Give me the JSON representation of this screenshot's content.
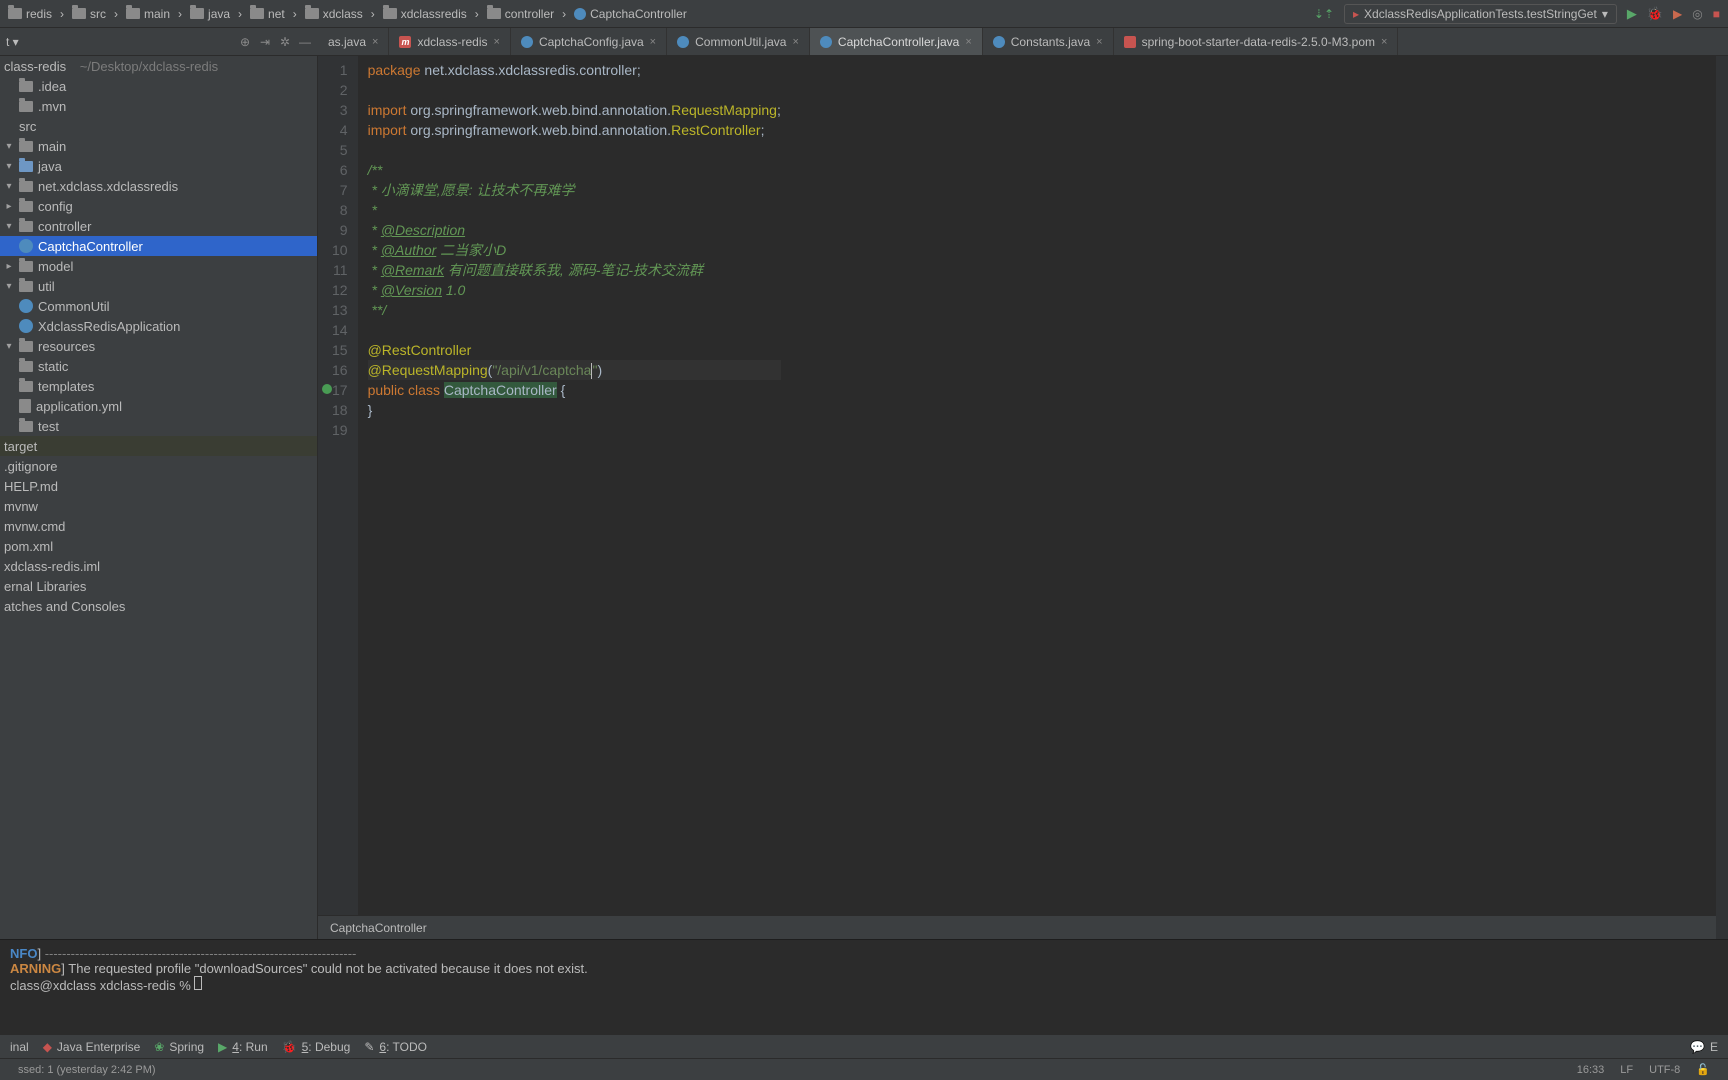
{
  "breadcrumbs": [
    "redis",
    "src",
    "main",
    "java",
    "net",
    "xdclass",
    "xdclassredis",
    "controller",
    "CaptchaController"
  ],
  "run_config": "XdclassRedisApplicationTests.testStringGet",
  "project": {
    "root_label": "class-redis",
    "root_path": "~/Desktop/xdclass-redis",
    "tool_label": "t",
    "nodes": {
      "idea": ".idea",
      "mvn": ".mvn",
      "src": "src",
      "main": "main",
      "java": "java",
      "pkg": "net.xdclass.xdclassredis",
      "config": "config",
      "controller": "controller",
      "captcha": "CaptchaController",
      "model": "model",
      "util": "util",
      "commonutil": "CommonUtil",
      "app": "XdclassRedisApplication",
      "resources": "resources",
      "static": "static",
      "templates": "templates",
      "appyml": "application.yml",
      "test": "test",
      "target": "target",
      "gitignore": ".gitignore",
      "help": "HELP.md",
      "mvnw": "mvnw",
      "mvnwcmd": "mvnw.cmd",
      "pom": "pom.xml",
      "iml": "xdclass-redis.iml",
      "extlib": "ernal Libraries",
      "scratch": "atches and Consoles"
    }
  },
  "tabs": [
    {
      "label": "as.java",
      "kind": "partial"
    },
    {
      "label": "xdclass-redis",
      "kind": "m"
    },
    {
      "label": "CaptchaConfig.java",
      "kind": "c"
    },
    {
      "label": "CommonUtil.java",
      "kind": "c"
    },
    {
      "label": "CaptchaController.java",
      "kind": "c",
      "active": true
    },
    {
      "label": "Constants.java",
      "kind": "c"
    },
    {
      "label": "spring-boot-starter-data-redis-2.5.0-M3.pom",
      "kind": "l"
    }
  ],
  "editor": {
    "crumb": "CaptchaController",
    "lines": [
      {
        "n": 1,
        "html": "<span class='kw'>package</span> net.xdclass.xdclassredis.controller;"
      },
      {
        "n": 2,
        "html": ""
      },
      {
        "n": 3,
        "html": "<span class='kw'>import</span> org.springframework.web.bind.annotation.<span class='ann'>RequestMapping</span>;"
      },
      {
        "n": 4,
        "html": "<span class='kw'>import</span> org.springframework.web.bind.annotation.<span class='ann'>RestController</span>;"
      },
      {
        "n": 5,
        "html": ""
      },
      {
        "n": 6,
        "html": "<span class='doc'>/**</span>"
      },
      {
        "n": 7,
        "html": "<span class='doc'> * 小滴课堂,愿景: 让技术不再难学</span>"
      },
      {
        "n": 8,
        "html": "<span class='doc'> *</span>"
      },
      {
        "n": 9,
        "html": "<span class='doc'> * <span class='doctag'>@Description</span></span>"
      },
      {
        "n": 10,
        "html": "<span class='doc'> * <span class='doctag'>@Author</span> 二当家小D</span>"
      },
      {
        "n": 11,
        "html": "<span class='doc'> * <span class='doctag'>@Remark</span> 有问题直接联系我, 源码-笔记-技术交流群</span>"
      },
      {
        "n": 12,
        "html": "<span class='doc'> * <span class='doctag'>@Version</span> 1.0</span>"
      },
      {
        "n": 13,
        "html": "<span class='doc'> **/</span>"
      },
      {
        "n": 14,
        "html": ""
      },
      {
        "n": 15,
        "html": "<span class='ann'>@RestController</span>"
      },
      {
        "n": 16,
        "html": "<span class='ann'>@RequestMapping</span>(<span class='str'>\"/api/v1/captcha</span><span class='caret'></span><span class='str'>\"</span>)",
        "hl": true
      },
      {
        "n": 17,
        "html": "<span class='kw'>public class</span> <span class='cls-hl'>CaptchaController</span> {",
        "mark": true
      },
      {
        "n": 18,
        "html": "}"
      },
      {
        "n": 19,
        "html": ""
      }
    ]
  },
  "terminal": {
    "l1_pre": "NFO",
    "l1_post": "] ",
    "dashes": "------------------------------------------------------------------------",
    "l2_pre": "ARNING",
    "l2_post": "] The requested profile \"downloadSources\" could not be activated because it does not exist.",
    "l3": "class@xdclass xdclass-redis % "
  },
  "bottom": {
    "terminal": "inal",
    "jee": "Java Enterprise",
    "spring": "Spring",
    "run": "4: Run",
    "run_u": "4",
    "debug": "5: Debug",
    "debug_u": "5",
    "todo": "6: TODO",
    "todo_u": "6",
    "event": "E"
  },
  "status": {
    "left": "ssed: 1 (yesterday 2:42 PM)",
    "pos": "16:33",
    "sep": "LF",
    "enc": "UTF-8"
  }
}
